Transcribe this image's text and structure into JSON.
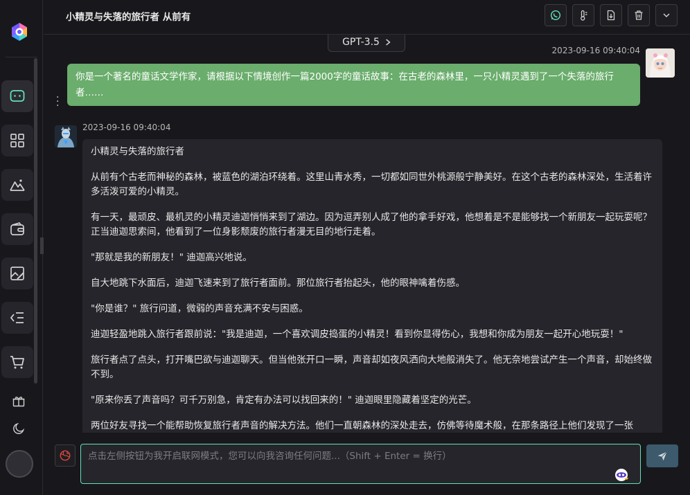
{
  "header": {
    "title": "小精灵与失落的旅行者 从前有"
  },
  "model": {
    "label": "GPT-3.5"
  },
  "messages": {
    "user": {
      "time": "2023-09-16 09:40:04",
      "text": "你是一个著名的童话文学作家，请根据以下情境创作一篇2000字的童话故事：在古老的森林里，一只小精灵遇到了一个失落的旅行者……"
    },
    "ai": {
      "time": "2023-09-16 09:40:04",
      "paragraphs": [
        "小精灵与失落的旅行者",
        "从前有个古老而神秘的森林，被蓝色的湖泊环绕着。这里山青水秀，一切都如同世外桃源般宁静美好。在这个古老的森林深处，生活着许多活泼可爱的小精灵。",
        "有一天，最顽皮、最机灵的小精灵迪迦悄悄来到了湖边。因为逗弄别人成了他的拿手好戏，他想着是不是能够找一个新朋友一起玩耍呢？正当迪迦思索间，他看到了一位身影颓废的旅行者漫无目的地行走着。",
        "\"那就是我的新朋友！\" 迪迦高兴地说。",
        "自大地跳下水面后，迪迦飞速来到了旅行者面前。那位旅行者抬起头，他的眼神噙着伤感。",
        "\"你是谁？\" 旅行问道，微弱的声音充满不安与困惑。",
        "迪迦轻盈地跳入旅行者跟前说：\"我是迪迦，一个喜欢调皮捣蛋的小精灵！看到你显得伤心，我想和你成为朋友一起开心地玩耍！\"",
        "旅行者点了点头，打开嘴巴欲与迪迦聊天。但当他张开口一瞬，声音却如夜风洒向大地般消失了。他无奈地尝试产生一个声音，却始终做不到。",
        "\"原来你丢了声音吗？可千万别急，肯定有办法可以找回来的！\" 迪迦眼里隐藏着坚定的光芒。",
        "两位好友寻找一个能帮助恢复旅行者声音的解决方法。他们一直朝森林的深处走去，仿佛等待魔术般，在那条路径上他们发现了一张"
      ]
    }
  },
  "input": {
    "placeholder": "点击左侧按钮为我开启联网模式，您可以向我咨询任何问题...（Shift + Enter = 换行）",
    "value": ""
  },
  "colors": {
    "accent": "#63e2b7",
    "user_bubble": "#6aad6c",
    "ai_bubble": "#25252b",
    "background": "#18181c",
    "send_button": "#3c5a6b"
  },
  "icons": {
    "sidebar": [
      "chat-icon",
      "apps-grid-icon",
      "image-icon",
      "wallet-icon",
      "sketch-icon",
      "list-icon",
      "cart-icon",
      "gift-icon",
      "moon-icon"
    ],
    "header": [
      "whatsapp-icon",
      "thermometer-icon",
      "export-icon",
      "trash-icon",
      "chevron-down-icon"
    ]
  }
}
